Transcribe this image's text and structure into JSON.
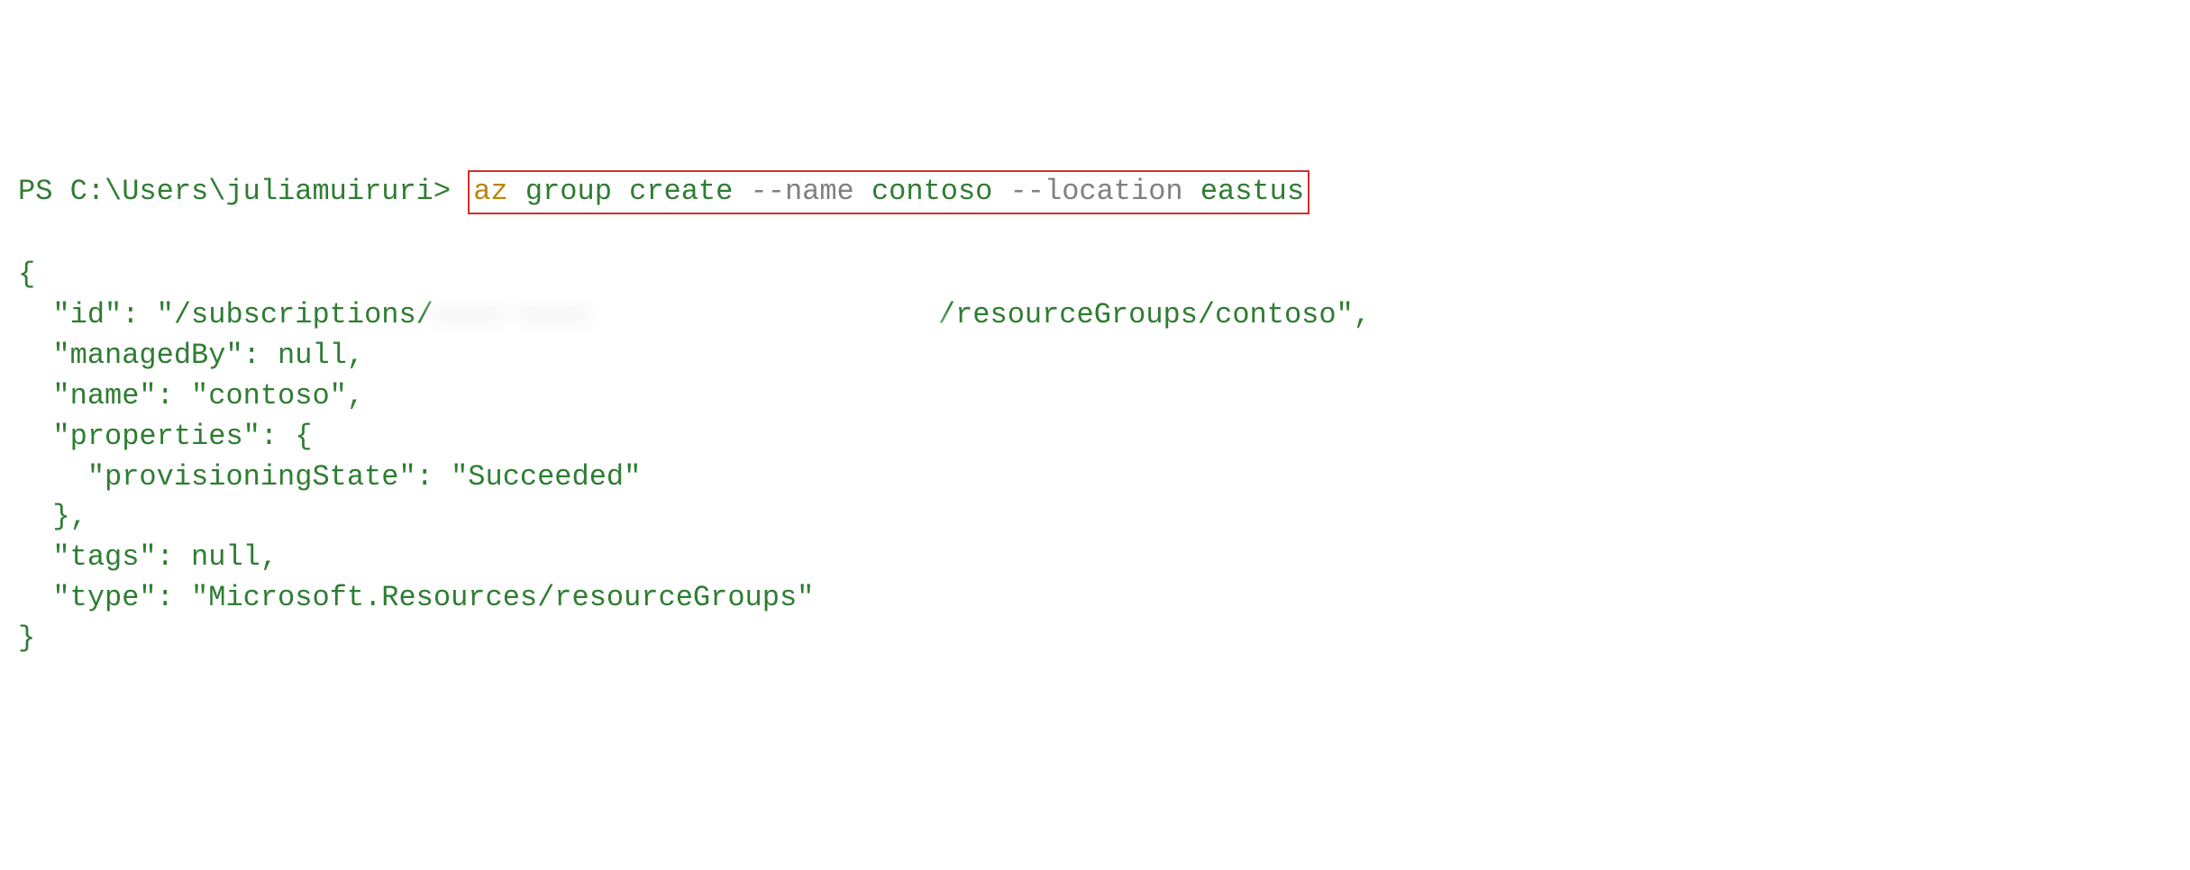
{
  "prompt": {
    "prefix": "PS C:\\Users\\juliamuiruri> ",
    "cmd_az": "az",
    "cmd_group": " group create ",
    "cmd_flag_name": "--name",
    "cmd_val_name": " contoso ",
    "cmd_flag_loc": "--location",
    "cmd_val_loc": " eastus"
  },
  "output": {
    "l1": "{",
    "l2a": "  \"id\": \"/subscriptions/",
    "l2b": "/resourceGroups/contoso\",",
    "l3": "  \"managedBy\": null,",
    "l4": "  \"name\": \"contoso\",",
    "l5": "  \"properties\": {",
    "l6": "    \"provisioningState\": \"Succeeded\"",
    "l7": "  },",
    "l8": "  \"tags\": null,",
    "l9": "  \"type\": \"Microsoft.Resources/resourceGroups\"",
    "l10": "}"
  }
}
